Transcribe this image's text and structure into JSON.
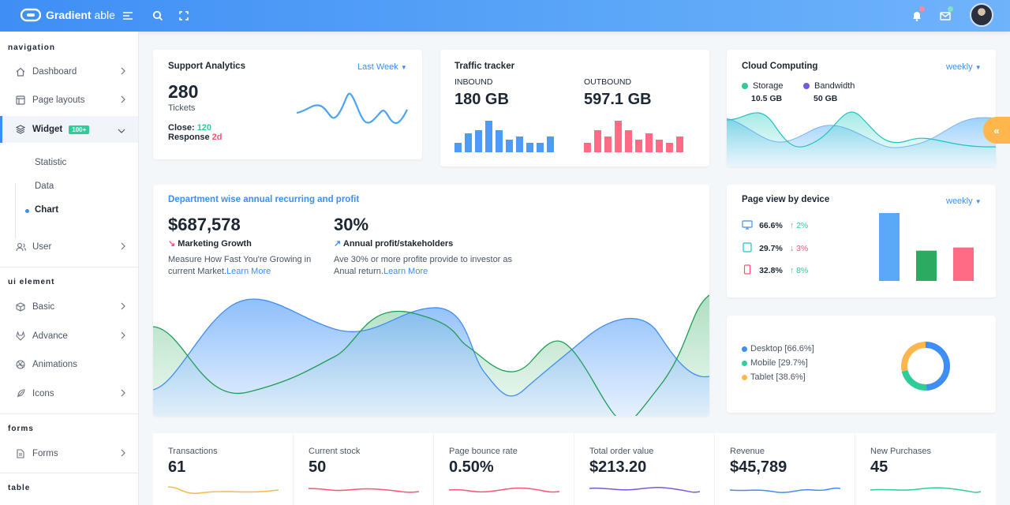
{
  "header": {
    "logo_text": "Gradient",
    "logo_thin": " able"
  },
  "sidebar": {
    "caption_navigation": "navigation",
    "caption_ui": "ui element",
    "caption_forms": "forms",
    "caption_table": "table",
    "items": {
      "dashboard": "Dashboard",
      "page_layouts": "Page layouts",
      "widget": "Widget",
      "widget_badge": "100+",
      "statistic": "Statistic",
      "data": "Data",
      "chart": "Chart",
      "user": "User",
      "basic": "Basic",
      "advance": "Advance",
      "animations": "Animations",
      "icons": "Icons",
      "forms": "Forms"
    }
  },
  "support": {
    "title": "Support Analytics",
    "filter": "Last Week",
    "value": "280",
    "unit": "Tickets",
    "close_label": "Close:",
    "close_value": "120",
    "response_label": "Response",
    "response_value": "2d"
  },
  "traffic": {
    "title": "Traffic tracker",
    "inbound_label": "INBOUND",
    "inbound_value": "180 GB",
    "outbound_label": "OUTBOUND",
    "outbound_value": "597.1 GB"
  },
  "cloud": {
    "title": "Cloud Computing",
    "filter": "weekly",
    "storage_label": "Storage",
    "storage_value": "10.5 GB",
    "bandwidth_label": "Bandwidth",
    "bandwidth_value": "50 GB"
  },
  "department": {
    "title": "Department wise annual recurring and profit",
    "left_value": "$687,578",
    "left_label": "Marketing Growth",
    "left_desc": "Measure How Fast You're Growing in current Market.",
    "left_link": "Learn More",
    "right_value": "30%",
    "right_label": "Annual profit/stakeholders",
    "right_desc": "Ave 30% or more profite provide to investor as Anual return.",
    "right_link": "Learn More"
  },
  "pageview": {
    "title": "Page view by device",
    "filter": "weekly",
    "rows": [
      {
        "pct": "66.6%",
        "change": "2%",
        "dir": "up"
      },
      {
        "pct": "29.7%",
        "change": "3%",
        "dir": "down"
      },
      {
        "pct": "32.8%",
        "change": "8%",
        "dir": "up"
      }
    ]
  },
  "donut": {
    "desktop": "Desktop [66.6%]",
    "mobile": "Mobile [29.7%]",
    "tablet": "Tablet [38.6%]"
  },
  "stats": [
    {
      "label": "Transactions",
      "value": "61"
    },
    {
      "label": "Current stock",
      "value": "50"
    },
    {
      "label": "Page bounce rate",
      "value": "0.50%"
    },
    {
      "label": "Total order value",
      "value": "$213.20"
    },
    {
      "label": "Revenue",
      "value": "$45,789"
    },
    {
      "label": "New Purchases",
      "value": "45"
    }
  ],
  "chart_data": [
    {
      "type": "bar",
      "series": [
        {
          "values": [
            3,
            6,
            7,
            10,
            7,
            4,
            5,
            3,
            3,
            5
          ]
        },
        {
          "values": [
            3,
            7,
            5,
            10,
            7,
            4,
            6,
            4,
            3,
            5
          ]
        }
      ]
    },
    {
      "type": "bar",
      "values": [
        66.6,
        29.7,
        32.8
      ]
    },
    {
      "type": "pie",
      "values": [
        66.6,
        29.7,
        38.6
      ]
    }
  ],
  "colors": {
    "primary": "#3f8ef5",
    "green": "#2ecc9a",
    "red": "#ff5370",
    "orange": "#ffb64d",
    "purple": "#7759de"
  }
}
